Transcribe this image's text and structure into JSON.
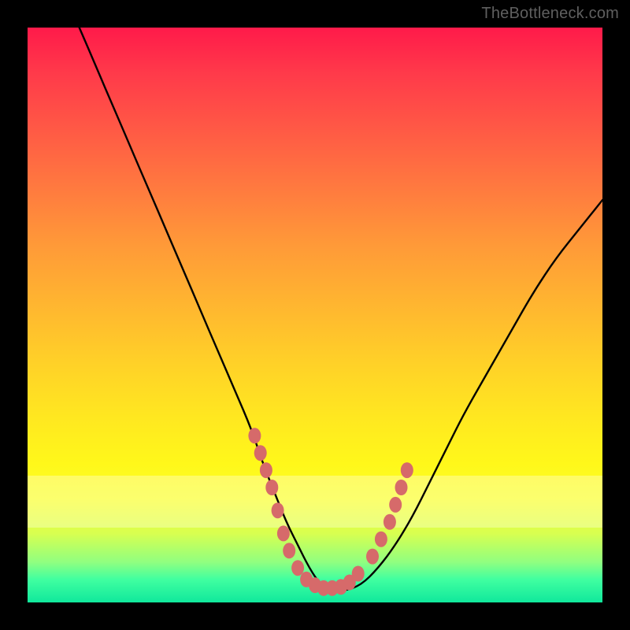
{
  "watermark": "TheBottleneck.com",
  "colors": {
    "frame": "#000000",
    "curve": "#000000",
    "dot_fill": "#d66a6a",
    "dot_stroke": "#b84f4f",
    "watermark": "#5f5f5f"
  },
  "chart_data": {
    "type": "line",
    "title": "",
    "xlabel": "",
    "ylabel": "",
    "xlim": [
      0,
      100
    ],
    "ylim": [
      0,
      100
    ],
    "grid": false,
    "legend": false,
    "series": [
      {
        "name": "bottleneck-curve",
        "x": [
          9,
          12,
          15,
          18,
          21,
          24,
          27,
          30,
          33,
          36,
          39,
          41,
          43,
          45,
          47,
          49,
          51,
          53,
          55,
          58,
          61,
          64,
          67,
          70,
          73,
          76,
          80,
          84,
          88,
          92,
          96,
          100
        ],
        "y": [
          100,
          93,
          86,
          79,
          72,
          65,
          58,
          51,
          44,
          37,
          30,
          24,
          19,
          14,
          10,
          6,
          3,
          2,
          2,
          3,
          6,
          10,
          15,
          21,
          27,
          33,
          40,
          47,
          54,
          60,
          65,
          70
        ]
      }
    ],
    "annotations": {
      "dots": [
        {
          "x": 39.5,
          "y": 29
        },
        {
          "x": 40.5,
          "y": 26
        },
        {
          "x": 41.5,
          "y": 23
        },
        {
          "x": 42.5,
          "y": 20
        },
        {
          "x": 43.5,
          "y": 16
        },
        {
          "x": 44.5,
          "y": 12
        },
        {
          "x": 45.5,
          "y": 9
        },
        {
          "x": 47,
          "y": 6
        },
        {
          "x": 48.5,
          "y": 4
        },
        {
          "x": 50,
          "y": 3
        },
        {
          "x": 51.5,
          "y": 2.5
        },
        {
          "x": 53,
          "y": 2.5
        },
        {
          "x": 54.5,
          "y": 2.7
        },
        {
          "x": 56,
          "y": 3.5
        },
        {
          "x": 57.5,
          "y": 5
        },
        {
          "x": 60,
          "y": 8
        },
        {
          "x": 61.5,
          "y": 11
        },
        {
          "x": 63,
          "y": 14
        },
        {
          "x": 64,
          "y": 17
        },
        {
          "x": 65,
          "y": 20
        },
        {
          "x": 66,
          "y": 23
        }
      ]
    }
  }
}
